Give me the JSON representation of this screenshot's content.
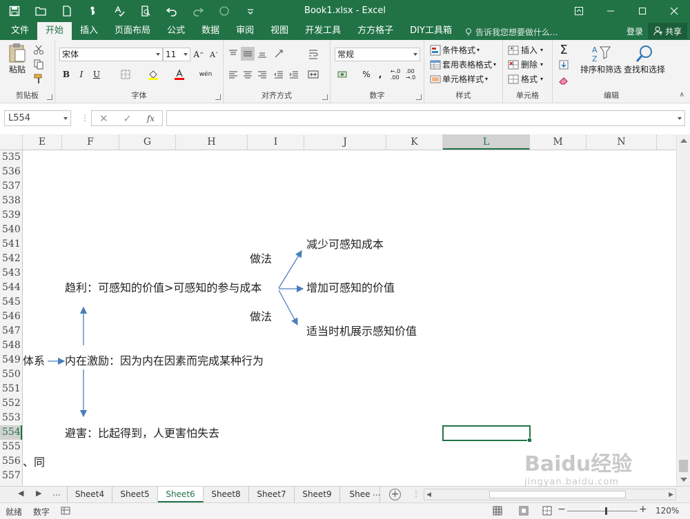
{
  "window": {
    "title": "Book1.xlsx - Excel",
    "accent_color": "#217346"
  },
  "tabs": [
    "文件",
    "开始",
    "插入",
    "页面布局",
    "公式",
    "数据",
    "审阅",
    "视图",
    "开发工具",
    "方方格子",
    "DIY工具箱"
  ],
  "active_tab": "开始",
  "tell_me": "告诉我您想要做什么...",
  "login": "登录",
  "share": "共享",
  "ribbon": {
    "clipboard": {
      "paste": "粘贴",
      "label": "剪贴板"
    },
    "font": {
      "name": "宋体",
      "size": "11",
      "label": "字体",
      "bold": "B",
      "italic": "I",
      "underline": "U",
      "grow": "A",
      "shrink": "A",
      "wen": "wén"
    },
    "alignment": {
      "label": "对齐方式"
    },
    "number": {
      "format": "常规",
      "label": "数字",
      "percent": "%",
      "comma": ","
    },
    "styles": {
      "conditional": "条件格式",
      "table": "套用表格格式",
      "cell": "单元格样式",
      "label": "样式"
    },
    "cells": {
      "insert": "插入",
      "delete": "删除",
      "format": "格式",
      "label": "单元格"
    },
    "editing": {
      "sort": "排序和筛选",
      "find": "查找和选择",
      "label": "编辑"
    }
  },
  "formula_bar": {
    "name_box": "L554",
    "fx": "fx",
    "formula": ""
  },
  "columns": [
    "E",
    "F",
    "G",
    "H",
    "I",
    "J",
    "K",
    "L",
    "M",
    "N"
  ],
  "selected_column": "L",
  "rows": [
    "535",
    "536",
    "537",
    "538",
    "539",
    "540",
    "541",
    "542",
    "543",
    "544",
    "545",
    "546",
    "547",
    "548",
    "549",
    "550",
    "551",
    "552",
    "553",
    "554",
    "555",
    "556",
    "557"
  ],
  "selected_row": "554",
  "cell_texts": {
    "reduce": "减少可感知成本",
    "method1": "做法",
    "profit": "趋利：可感知的价值>可感知的参与成本",
    "increase": "增加可感知的价值",
    "method2": "做法",
    "timing": "适当时机展示感知价值",
    "system": "体系",
    "intrinsic": "内在激励：因为内在因素而完成某种行为",
    "avoid": "避害：比起得到，人更害怕失去",
    "same": "、同"
  },
  "sheets": [
    "Sheet4",
    "Sheet5",
    "Sheet6",
    "Sheet8",
    "Sheet7",
    "Sheet9",
    "Shee"
  ],
  "active_sheet": "Sheet6",
  "sheet_nav_more": "...",
  "status": {
    "ready": "就绪",
    "mode": "数字",
    "zoom": "120%",
    "zoom_level": 1.2
  },
  "watermark": {
    "main": "Baidu经验",
    "sub": "jingyan.baidu.com"
  }
}
